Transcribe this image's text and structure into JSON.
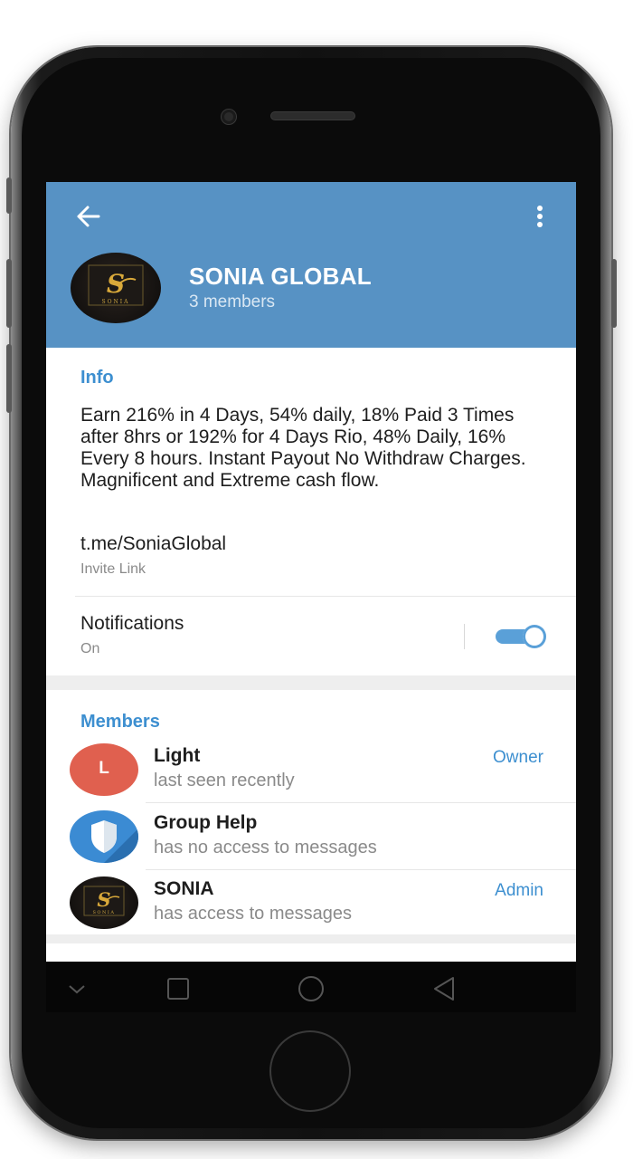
{
  "header": {
    "group_name": "SONIA GLOBAL",
    "member_count": "3 members",
    "avatar_text": "SONIA"
  },
  "info": {
    "section_title": "Info",
    "description": "Earn 216% in 4 Days, 54% daily, 18% Paid 3 Times after 8hrs or 192% for 4 Days Rio, 48% Daily, 16% Every 8 hours. Instant Payout No Withdraw Charges. Magnificent and Extreme cash flow.",
    "link": "t.me/SoniaGlobal",
    "link_caption": "Invite Link",
    "notifications_label": "Notifications",
    "notifications_state": "On",
    "notifications_enabled": true
  },
  "members": {
    "section_title": "Members",
    "list": [
      {
        "name": "Light",
        "status": "last seen recently",
        "role": "Owner",
        "avatar_letter": "L",
        "avatar_color": "#e0604f"
      },
      {
        "name": "Group Help",
        "status": "has no access to messages",
        "role": "",
        "avatar_icon": "shield-icon",
        "avatar_color": "#3b8bd3"
      },
      {
        "name": "SONIA",
        "status": "has access to messages",
        "role": "Admin",
        "avatar_text": "SONIA"
      }
    ]
  },
  "colors": {
    "header_bg": "#5792c4",
    "accent": "#3d8fd0",
    "toggle_on": "#5aa0d8"
  },
  "icons": {
    "back": "arrow-left-icon",
    "menu": "more-vertical-icon",
    "nav_back": "triangle-back-icon",
    "nav_home": "circle-home-icon",
    "nav_recents": "square-recents-icon"
  }
}
